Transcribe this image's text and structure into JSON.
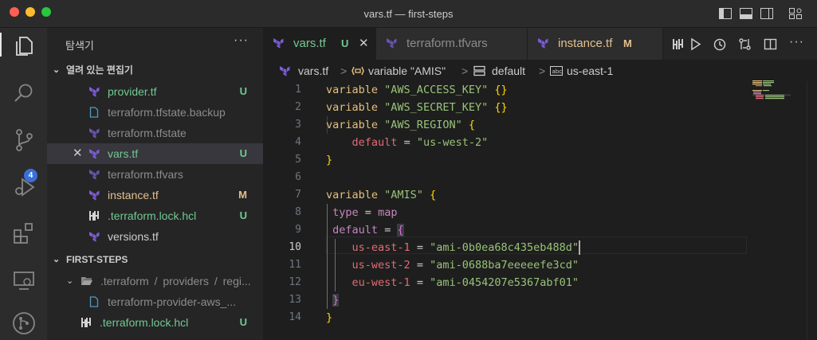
{
  "window": {
    "title": "vars.tf — first-steps"
  },
  "activity_bar": {
    "scm_badge": "4"
  },
  "sidebar": {
    "header": "탐색기",
    "more": "···",
    "open_editors": {
      "title": "열려 있는 편집기",
      "items": [
        {
          "name": "provider.tf",
          "status": "U"
        },
        {
          "name": "terraform.tfstate.backup",
          "status": ""
        },
        {
          "name": "terraform.tfstate",
          "status": ""
        },
        {
          "name": "vars.tf",
          "status": "U",
          "close": "✕"
        },
        {
          "name": "terraform.tfvars",
          "status": ""
        },
        {
          "name": "instance.tf",
          "status": "M"
        },
        {
          "name": ".terraform.lock.hcl",
          "status": "U"
        },
        {
          "name": "versions.tf",
          "status": ""
        }
      ]
    },
    "project": {
      "title": "FIRST-STEPS",
      "items": [
        {
          "name_parts": [
            ".terraform",
            "/",
            "providers",
            "/",
            "regi..."
          ]
        },
        {
          "name": "terraform-provider-aws_..."
        },
        {
          "name": ".terraform.lock.hcl",
          "status": "U"
        }
      ]
    }
  },
  "tabs": [
    {
      "label": "vars.tf",
      "status": "U",
      "close": "✕"
    },
    {
      "label": "terraform.tfvars"
    },
    {
      "label": "instance.tf",
      "status": "M"
    }
  ],
  "breadcrumb": {
    "file": "vars.tf",
    "sep": ">",
    "variable": "variable \"AMIS\"",
    "default": "default",
    "key": "us-east-1"
  },
  "editor": {
    "line_numbers": [
      "1",
      "2",
      "3",
      "4",
      "5",
      "6",
      "7",
      "8",
      "9",
      "10",
      "11",
      "12",
      "13",
      "14"
    ],
    "current_line": "10",
    "lines": {
      "l1": {
        "kw": "variable",
        "str": "\"AWS_ACCESS_KEY\"",
        "br": "{}"
      },
      "l2": {
        "kw": "variable",
        "str": "\"AWS_SECRET_KEY\"",
        "br": "{}"
      },
      "l3": {
        "kw": "variable",
        "str": "\"AWS_REGION\"",
        "br": "{"
      },
      "l4": {
        "attr": "default",
        "eq": "=",
        "str": "\"us-west-2\""
      },
      "l5": {
        "br": "}"
      },
      "l7": {
        "kw": "variable",
        "str": "\"AMIS\"",
        "br": "{"
      },
      "l8": {
        "attr": "type",
        "eq": "=",
        "val": "map"
      },
      "l9": {
        "attr": "default",
        "eq": "=",
        "br": "{"
      },
      "l10": {
        "attr": "us-east-1",
        "eq": "=",
        "str": "\"ami-0b0ea68c435eb488d\""
      },
      "l11": {
        "attr": "us-west-2",
        "eq": "=",
        "str": "\"ami-0688ba7eeeeefe3cd\""
      },
      "l12": {
        "attr": "eu-west-1",
        "eq": "=",
        "str": "\"ami-0454207e5367abf01\""
      },
      "l13": {
        "br": "}"
      },
      "l14": {
        "br": "}"
      }
    }
  },
  "colors": {
    "accent": "#3a6fd8",
    "untracked": "#73c991",
    "modified": "#e2c08d",
    "terraform": "#7b5cd6"
  }
}
